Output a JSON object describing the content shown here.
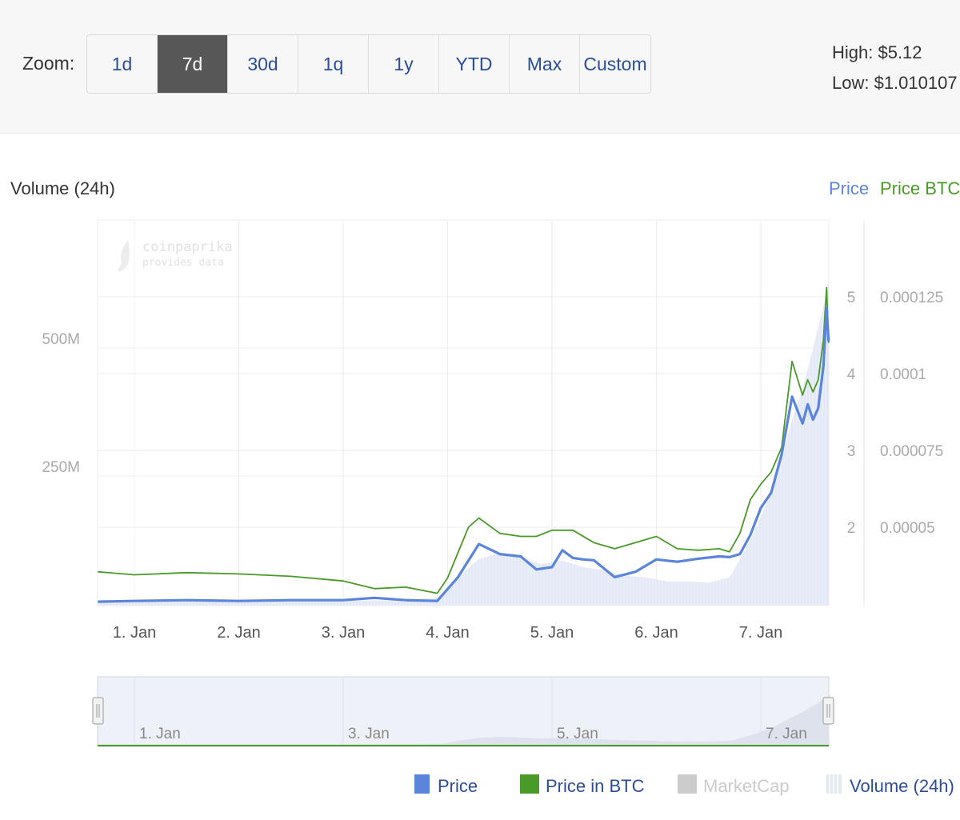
{
  "toolbar": {
    "zoom_label": "Zoom:",
    "buttons": [
      {
        "label": "1d",
        "active": false
      },
      {
        "label": "7d",
        "active": true
      },
      {
        "label": "30d",
        "active": false
      },
      {
        "label": "1q",
        "active": false
      },
      {
        "label": "1y",
        "active": false
      },
      {
        "label": "YTD",
        "active": false
      },
      {
        "label": "Max",
        "active": false
      },
      {
        "label": "Custom",
        "active": false
      }
    ],
    "high": "High: $5.12",
    "low": "Low: $1.010107"
  },
  "watermark": {
    "line1": "coinpaprika",
    "line2": "provides data"
  },
  "colors": {
    "price": "#5b84dc",
    "price_btc": "#4a9a2a",
    "marketcap": "#cccccc",
    "volume": "#dfe6f4",
    "active_button": "#575757",
    "link_blue": "#2a4d9c"
  },
  "chart_data": {
    "type": "line",
    "left_axis_title": "Volume (24h)",
    "right_axis_titles": {
      "price": "Price",
      "price_btc": "Price BTC"
    },
    "x_axis": {
      "type": "datetime",
      "tick_labels": [
        "1. Jan",
        "2. Jan",
        "3. Jan",
        "4. Jan",
        "5. Jan",
        "6. Jan",
        "7. Jan"
      ],
      "range": [
        0.0,
        6.65
      ]
    },
    "y_volume": {
      "ticks": [
        250000000,
        500000000
      ],
      "tick_labels": [
        "250M",
        "500M"
      ],
      "range": [
        0,
        850000000
      ]
    },
    "y_price": {
      "ticks": [
        2,
        3,
        4,
        5
      ],
      "tick_labels": [
        "2",
        "3",
        "4",
        "5"
      ],
      "range": [
        1.0,
        6.0
      ]
    },
    "y_price_btc": {
      "ticks": [
        5e-05,
        7.5e-05,
        0.0001,
        0.000125
      ],
      "tick_labels": [
        "0.00005",
        "0.000075",
        "0.0001",
        "0.000125"
      ],
      "range": [
        2.5e-05,
        0.00015
      ]
    },
    "series": [
      {
        "name": "Price",
        "axis": "price",
        "x": [
          -0.35,
          0.0,
          0.5,
          1.0,
          1.5,
          2.0,
          2.3,
          2.6,
          2.9,
          3.1,
          3.3,
          3.5,
          3.7,
          3.85,
          4.0,
          4.1,
          4.2,
          4.3,
          4.4,
          4.6,
          4.8,
          5.0,
          5.2,
          5.4,
          5.6,
          5.7,
          5.8,
          5.9,
          6.0,
          6.1,
          6.2,
          6.3,
          6.4,
          6.45,
          6.5,
          6.55,
          6.6,
          6.63,
          6.65
        ],
        "y": [
          1.03,
          1.04,
          1.05,
          1.04,
          1.05,
          1.05,
          1.08,
          1.05,
          1.04,
          1.35,
          1.78,
          1.65,
          1.62,
          1.45,
          1.48,
          1.7,
          1.6,
          1.58,
          1.57,
          1.35,
          1.42,
          1.58,
          1.55,
          1.59,
          1.62,
          1.61,
          1.65,
          1.9,
          2.25,
          2.45,
          2.95,
          3.7,
          3.35,
          3.6,
          3.4,
          3.55,
          4.1,
          4.85,
          4.42
        ]
      },
      {
        "name": "Price in BTC",
        "axis": "price_btc",
        "x": [
          -0.35,
          0.0,
          0.5,
          1.0,
          1.5,
          2.0,
          2.3,
          2.6,
          2.9,
          3.0,
          3.2,
          3.3,
          3.5,
          3.7,
          3.85,
          4.0,
          4.2,
          4.4,
          4.6,
          4.8,
          5.0,
          5.2,
          5.4,
          5.6,
          5.7,
          5.8,
          5.9,
          6.0,
          6.1,
          6.2,
          6.3,
          6.4,
          6.45,
          6.5,
          6.55,
          6.6,
          6.63,
          6.65
        ],
        "y": [
          3.55e-05,
          3.45e-05,
          3.52e-05,
          3.48e-05,
          3.4e-05,
          3.25e-05,
          3e-05,
          3.05e-05,
          2.85e-05,
          3.35e-05,
          5e-05,
          5.3e-05,
          4.8e-05,
          4.7e-05,
          4.7e-05,
          4.9e-05,
          4.9e-05,
          4.5e-05,
          4.3e-05,
          4.5e-05,
          4.7e-05,
          4.3e-05,
          4.25e-05,
          4.3e-05,
          4.2e-05,
          4.8e-05,
          5.9e-05,
          6.4e-05,
          6.8e-05,
          7.6e-05,
          0.000104,
          9.3e-05,
          9.8e-05,
          9.4e-05,
          9.8e-05,
          0.000111,
          0.000128,
          0.00011
        ]
      },
      {
        "name": "MarketCap",
        "visible": false
      },
      {
        "name": "Volume (24h)",
        "axis": "volume",
        "x": [
          -0.35,
          0.0,
          1.0,
          2.0,
          2.6,
          2.9,
          3.0,
          3.1,
          3.3,
          3.5,
          3.7,
          3.9,
          4.1,
          4.3,
          4.5,
          4.7,
          4.9,
          5.1,
          5.3,
          5.5,
          5.7,
          5.8,
          5.9,
          6.0,
          6.1,
          6.2,
          6.3,
          6.4,
          6.5,
          6.6,
          6.65
        ],
        "y": [
          5000000,
          5000000,
          5000000,
          6000000,
          8000000,
          12000000,
          28000000,
          52000000,
          88000000,
          100000000,
          90000000,
          78000000,
          85000000,
          72000000,
          66000000,
          55000000,
          52000000,
          44000000,
          44000000,
          42000000,
          52000000,
          88000000,
          125000000,
          170000000,
          218000000,
          285000000,
          360000000,
          420000000,
          500000000,
          580000000,
          630000000
        ]
      }
    ],
    "navigator": {
      "tick_labels": [
        "1. Jan",
        "3. Jan",
        "5. Jan",
        "7. Jan"
      ]
    },
    "legend": {
      "position": "bottom-right",
      "items": [
        "Price",
        "Price in BTC",
        "MarketCap",
        "Volume (24h)"
      ]
    }
  }
}
